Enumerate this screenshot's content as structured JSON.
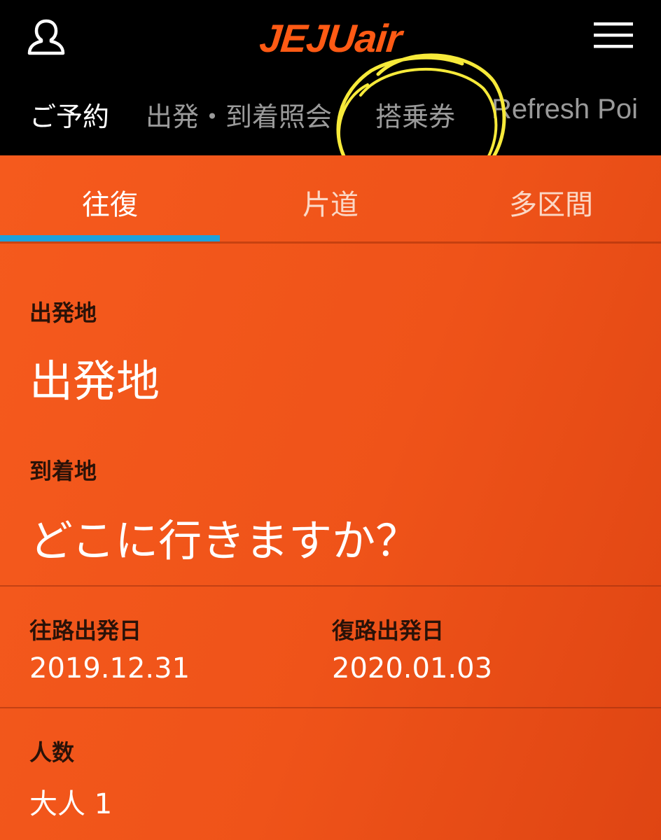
{
  "header": {
    "logo_text": "JEJUair",
    "user_icon": "user-icon",
    "menu_icon": "hamburger-menu-icon",
    "nav": [
      {
        "label": "ご予約"
      },
      {
        "label": "出発・到着照会"
      },
      {
        "label": "搭乗券"
      },
      {
        "label": "Refresh Poi"
      }
    ]
  },
  "trip_tabs": [
    {
      "label": "往復"
    },
    {
      "label": "片道"
    },
    {
      "label": "多区間"
    }
  ],
  "form": {
    "origin_label": "出発地",
    "origin_value": "出発地",
    "destination_label": "到着地",
    "destination_value": "どこに行きますか？",
    "outbound_label": "往路出発日",
    "outbound_value": "2019.12.31",
    "return_label": "復路出発日",
    "return_value": "2020.01.03",
    "passengers_label": "人数",
    "passengers_value": "大人 1"
  },
  "colors": {
    "brand_orange": "#ee5419",
    "header_black": "#000000",
    "tab_indicator": "#1da1dc",
    "highlight_yellow": "#f7ea3a"
  }
}
